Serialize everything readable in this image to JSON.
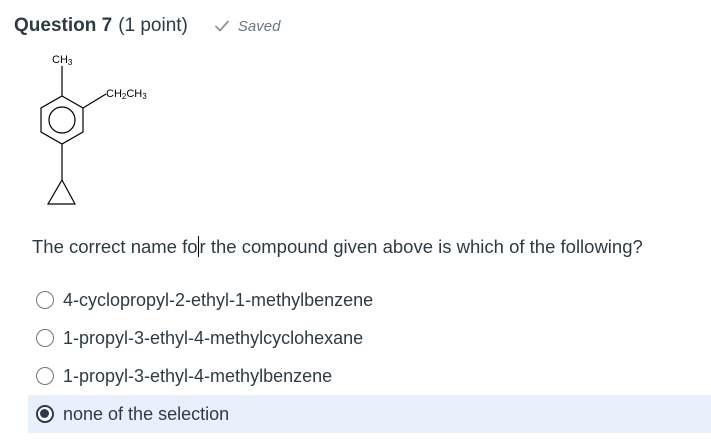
{
  "question": {
    "title": "Question 7",
    "points": "(1 point)",
    "status": "Saved",
    "status_icon": "check-icon",
    "prompt_before_caret": "The correct name fo",
    "prompt_after_caret": "r the compound given above is which of the following?"
  },
  "structure": {
    "substituent_top": "CH3",
    "substituent_side": "CH2CH3"
  },
  "options": [
    {
      "label": "4-cyclopropyl-2-ethyl-1-methylbenzene",
      "selected": false
    },
    {
      "label": "1-propyl-3-ethyl-4-methylcyclohexane",
      "selected": false
    },
    {
      "label": "1-propyl-3-ethyl-4-methylbenzene",
      "selected": false
    },
    {
      "label": "none of the selection",
      "selected": true
    }
  ],
  "colors": {
    "text": "#2d3b45",
    "muted": "#6b7780",
    "selected_bg": "#e7f0fb"
  }
}
